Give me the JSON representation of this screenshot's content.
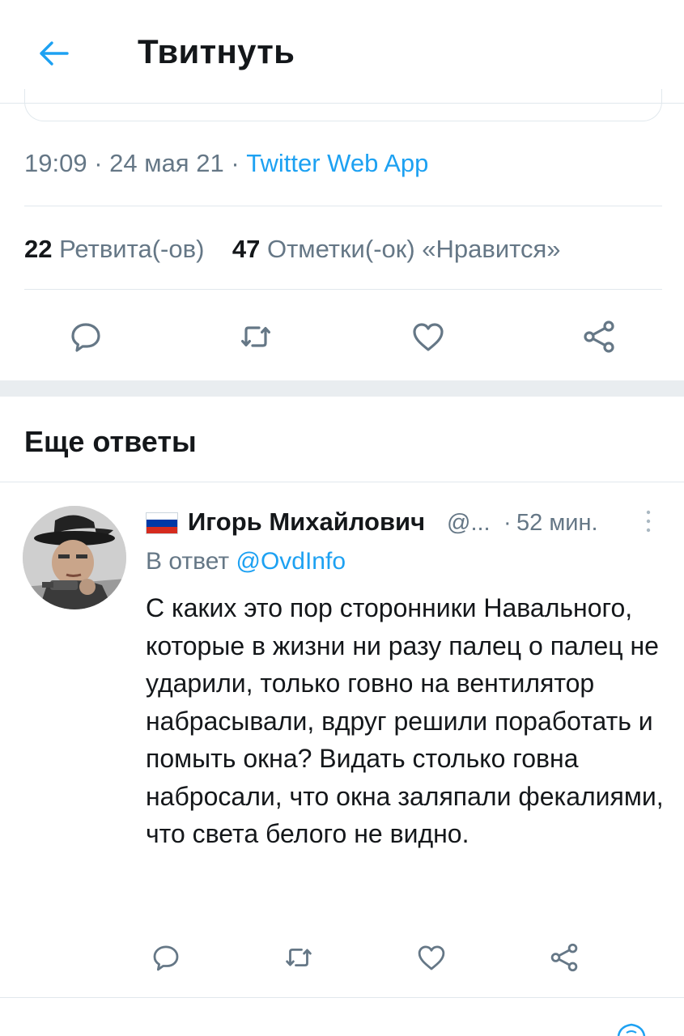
{
  "header": {
    "title": "Твитнуть",
    "back_icon": "arrow-left-icon",
    "accent": "#1da1f2"
  },
  "tweet": {
    "time": "19:09",
    "date": "24 мая 21",
    "separator": "·",
    "app": "Twitter Web App",
    "retweets": {
      "count": "22",
      "label": "Ретвита(-ов)"
    },
    "likes": {
      "count": "47",
      "label": "Отметки(-ок) «Нравится»"
    },
    "actions": [
      "reply-icon",
      "retweet-icon",
      "like-icon",
      "share-icon"
    ]
  },
  "more_replies": {
    "title": "Еще ответы"
  },
  "reply": {
    "flag": "russia-flag",
    "name": "Игорь Михайлович",
    "handle": "@...",
    "separator": "·",
    "time": "52 мин.",
    "reply_prefix": "В ответ",
    "reply_to": "@OvdInfo",
    "text": "С каких это пор сторонники Навального, которые в жизни ни разу палец о палец не ударили, только говно на вентилятор набрасывали, вдруг решили поработать и помыть окна? Видать столько говна набросали, что окна заляпали фекалиями, что света белого не видно.",
    "actions": [
      "reply-icon",
      "retweet-icon",
      "like-icon",
      "share-icon"
    ]
  },
  "colors": {
    "text": "#14171a",
    "secondary": "#657786",
    "link": "#1da1f2",
    "divider": "#e1e8ed"
  }
}
